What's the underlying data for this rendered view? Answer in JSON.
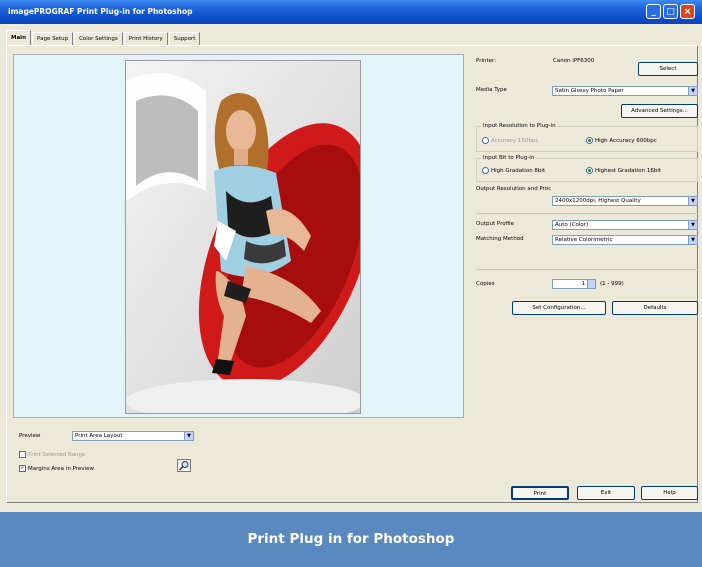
{
  "window": {
    "title": "imagePROGRAF Print Plug-in for Photoshop",
    "controls": {
      "minimize": "_",
      "maximize": "□",
      "close": "×"
    }
  },
  "tabs": [
    "Main",
    "Page Setup",
    "Color Settings",
    "Print History",
    "Support"
  ],
  "printer": {
    "label": "Printer:",
    "value": "Canon iPF6300",
    "select_button": "Select"
  },
  "media_type": {
    "label": "Media Type",
    "value": "Satin Glossy Photo Paper",
    "advanced_button": "Advanced Settings..."
  },
  "input_resolution": {
    "label": "Input Resolution to Plug-in",
    "options": [
      {
        "label": "Accuracy 150bpc",
        "selected": false,
        "disabled": true
      },
      {
        "label": "High Accuracy 600bpc",
        "selected": true,
        "disabled": false
      }
    ]
  },
  "input_bit": {
    "label": "Input Bit to Plug-in",
    "options": [
      {
        "label": "High Gradation 8bit",
        "selected": false
      },
      {
        "label": "Highest Gradation 16bit",
        "selected": true
      }
    ]
  },
  "output_profile_and_proc": {
    "label": "Output Resolution and Proc",
    "value": "2400x1200dpi, Highest Quality"
  },
  "output_profile": {
    "label": "Output Profile",
    "value": "Auto (Color)"
  },
  "matching_method": {
    "label": "Matching Method",
    "value": "Relative Colorimetric"
  },
  "copies": {
    "label": "Copies",
    "value": "1",
    "range": "(1 - 999)"
  },
  "buttons": {
    "set_configuration": "Set Configuration...",
    "defaults": "Defaults"
  },
  "preview": {
    "label": "Preview",
    "value": "Print Area Layout"
  },
  "checkboxes": [
    {
      "label": "Print Selected Range",
      "checked": false,
      "disabled": true
    },
    {
      "label": "Margins Area in Preview",
      "checked": true,
      "disabled": false
    }
  ],
  "footer_buttons": {
    "print": "Print",
    "exit": "Exit",
    "help": "Help"
  },
  "caption": "Print Plug in for Photoshop",
  "colors": {
    "titlebar": "#0a49c4",
    "caption_bg": "#5a89bf",
    "preview_bg": "#e2f4fa",
    "chair_red": "#d01a1a"
  }
}
